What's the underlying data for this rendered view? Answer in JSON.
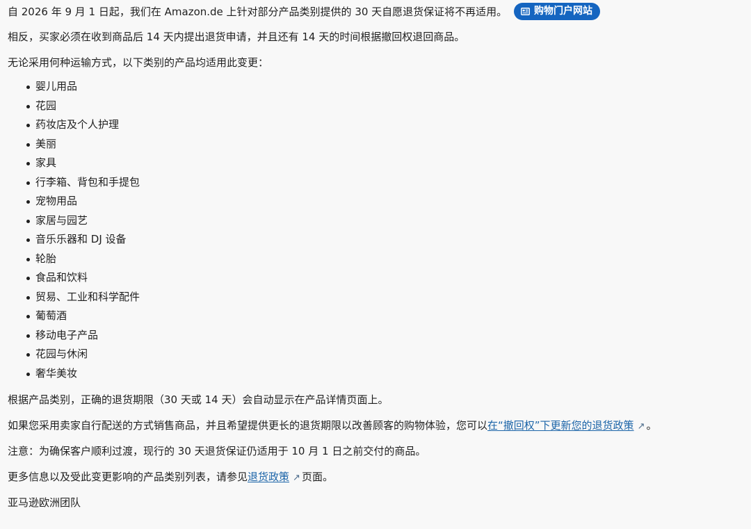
{
  "intro": {
    "text": "自 2026 年 9 月 1 日起，我们在 Amazon.de 上针对部分产品类别提供的 30 天自愿退货保证将不再适用。",
    "badge": {
      "icon": "newspaper-icon",
      "label": "购物门户网站",
      "color": "#1565c0"
    }
  },
  "paragraph_2": "相反，买家必须在收到商品后 14 天内提出退货申请，并且还有 14 天的时间根据撤回权退回商品。",
  "paragraph_3": "无论采用何种运输方式，以下类别的产品均适用此变更：",
  "categories": [
    "婴儿用品",
    "花园",
    "药妆店及个人护理",
    "美丽",
    "家具",
    "行李箱、背包和手提包",
    "宠物用品",
    "家居与园艺",
    "音乐乐器和 DJ 设备",
    "轮胎",
    "食品和饮料",
    "贸易、工业和科学配件",
    "葡萄酒",
    "移动电子产品",
    "花园与休闲",
    "奢华美妆"
  ],
  "paragraph_4": "根据产品类别，正确的退货期限（30 天或 14 天）会自动显示在产品详情页面上。",
  "paragraph_5": {
    "before": "如果您采用卖家自行配送的方式销售商品，并且希望提供更长的退货期限以改善顾客的购物体验，您可以",
    "link": "在“撤回权”下更新您的退货政策",
    "ext_icon": "external-link-icon",
    "after": "。"
  },
  "paragraph_6": "注意：为确保客户顺利过渡，现行的 30 天退货保证仍适用于 10 月 1 日之前交付的商品。",
  "paragraph_7": {
    "before": "更多信息以及受此变更影响的产品类别列表，请参见",
    "link": "退货政策",
    "ext_icon": "external-link-icon",
    "after": "页面。"
  },
  "signature": "亚马逊欧洲团队"
}
